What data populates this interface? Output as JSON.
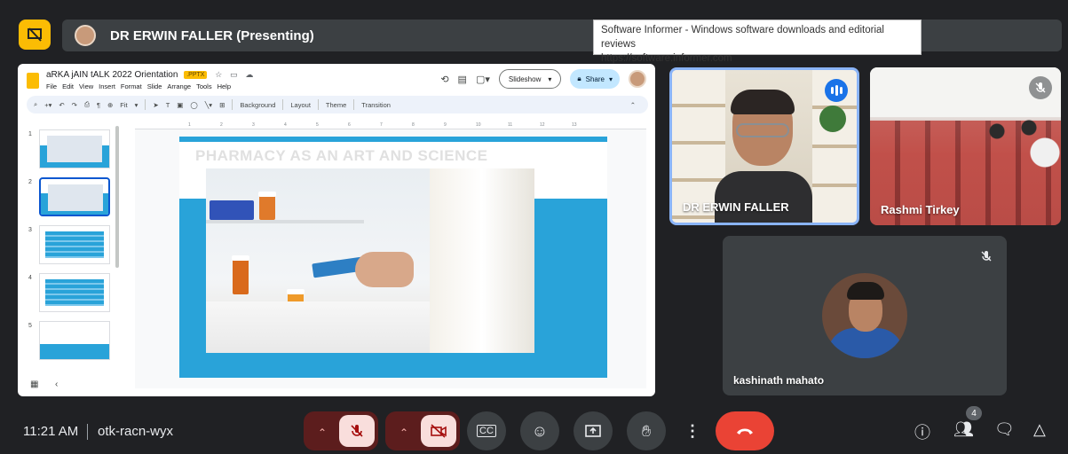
{
  "header": {
    "presenter_label": "DR ERWIN FALLER (Presenting)"
  },
  "tooltip": {
    "line1": "Software Informer - Windows software downloads and editorial reviews",
    "line2": "https://software.informer.com"
  },
  "slides_app": {
    "doc_title": "aRKA jAIN tALK 2022 Orientation",
    "badge": ".PPTX",
    "menu": [
      "File",
      "Edit",
      "View",
      "Insert",
      "Format",
      "Slide",
      "Arrange",
      "Tools",
      "Help"
    ],
    "slideshow_label": "Slideshow",
    "share_label": "Share",
    "toolbar": {
      "zoom": "Fit",
      "background": "Background",
      "layout": "Layout",
      "theme": "Theme",
      "transition": "Transition"
    },
    "ruler_ticks": [
      "1",
      "2",
      "3",
      "4",
      "5",
      "6",
      "7",
      "8",
      "9",
      "10",
      "11",
      "12",
      "13"
    ],
    "thumbnails": [
      "1",
      "2",
      "3",
      "4",
      "5"
    ],
    "slide_title": "PHARMACY AS AN ART AND SCIENCE"
  },
  "participants": [
    {
      "name": "DR ERWIN FALLER",
      "state": "speaking"
    },
    {
      "name": "Rashmi Tirkey",
      "state": "muted"
    },
    {
      "name": "kashinath mahato",
      "state": "muted"
    }
  ],
  "footer": {
    "time": "11:21 AM",
    "meeting_code": "otk-racn-wyx",
    "people_count": "4"
  },
  "colors": {
    "accent_blue": "#8ab4f8",
    "hangup_red": "#ea4335",
    "present_yellow": "#fbbc04",
    "slide_blue": "#29a3d9"
  }
}
